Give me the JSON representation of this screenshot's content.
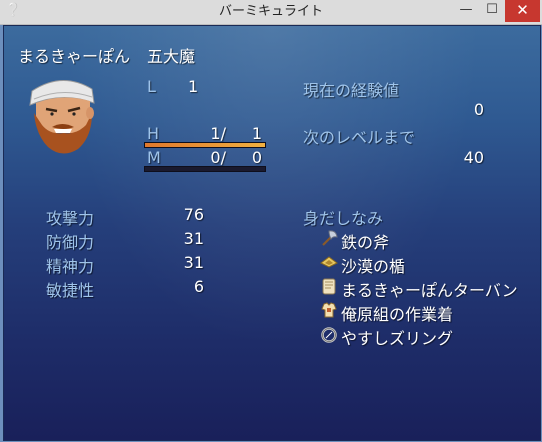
{
  "window": {
    "title": "バーミキュライト",
    "min_glyph": "—",
    "max_glyph": "☐",
    "close_glyph": "✕",
    "app_glyph": "❔"
  },
  "actor": {
    "name": "まるきゃーぽん",
    "class": "五大魔",
    "level_label": "L",
    "level": "1",
    "hp_label": "H",
    "hp_text": "1/",
    "hp_max": "1",
    "hp_fraction": 1.0,
    "mp_label": "M",
    "mp_text": "0/",
    "mp_max": "0",
    "mp_fraction": 0.0
  },
  "exp": {
    "current_label": "現在の経験値",
    "current_value": "0",
    "next_label": "次のレベルまで",
    "next_value": "40"
  },
  "params": [
    {
      "label": "攻撃力",
      "value": "76"
    },
    {
      "label": "防御力",
      "value": "31"
    },
    {
      "label": "精神力",
      "value": "31"
    },
    {
      "label": "敏捷性",
      "value": "6"
    }
  ],
  "equipment": {
    "header": "身だしなみ",
    "items": [
      {
        "icon": "axe-icon",
        "name": "鉄の斧"
      },
      {
        "icon": "shield-icon",
        "name": "沙漠の楯"
      },
      {
        "icon": "headgear-icon",
        "name": "まるきゃーぽんターバン"
      },
      {
        "icon": "armor-icon",
        "name": "俺原組の作業着"
      },
      {
        "icon": "ring-icon",
        "name": "やすしズリング"
      }
    ]
  },
  "colors": {
    "system": "#9fc4ea",
    "text": "#ffffff",
    "hp_gauge": "#e0782c",
    "close": "#c7372f"
  }
}
